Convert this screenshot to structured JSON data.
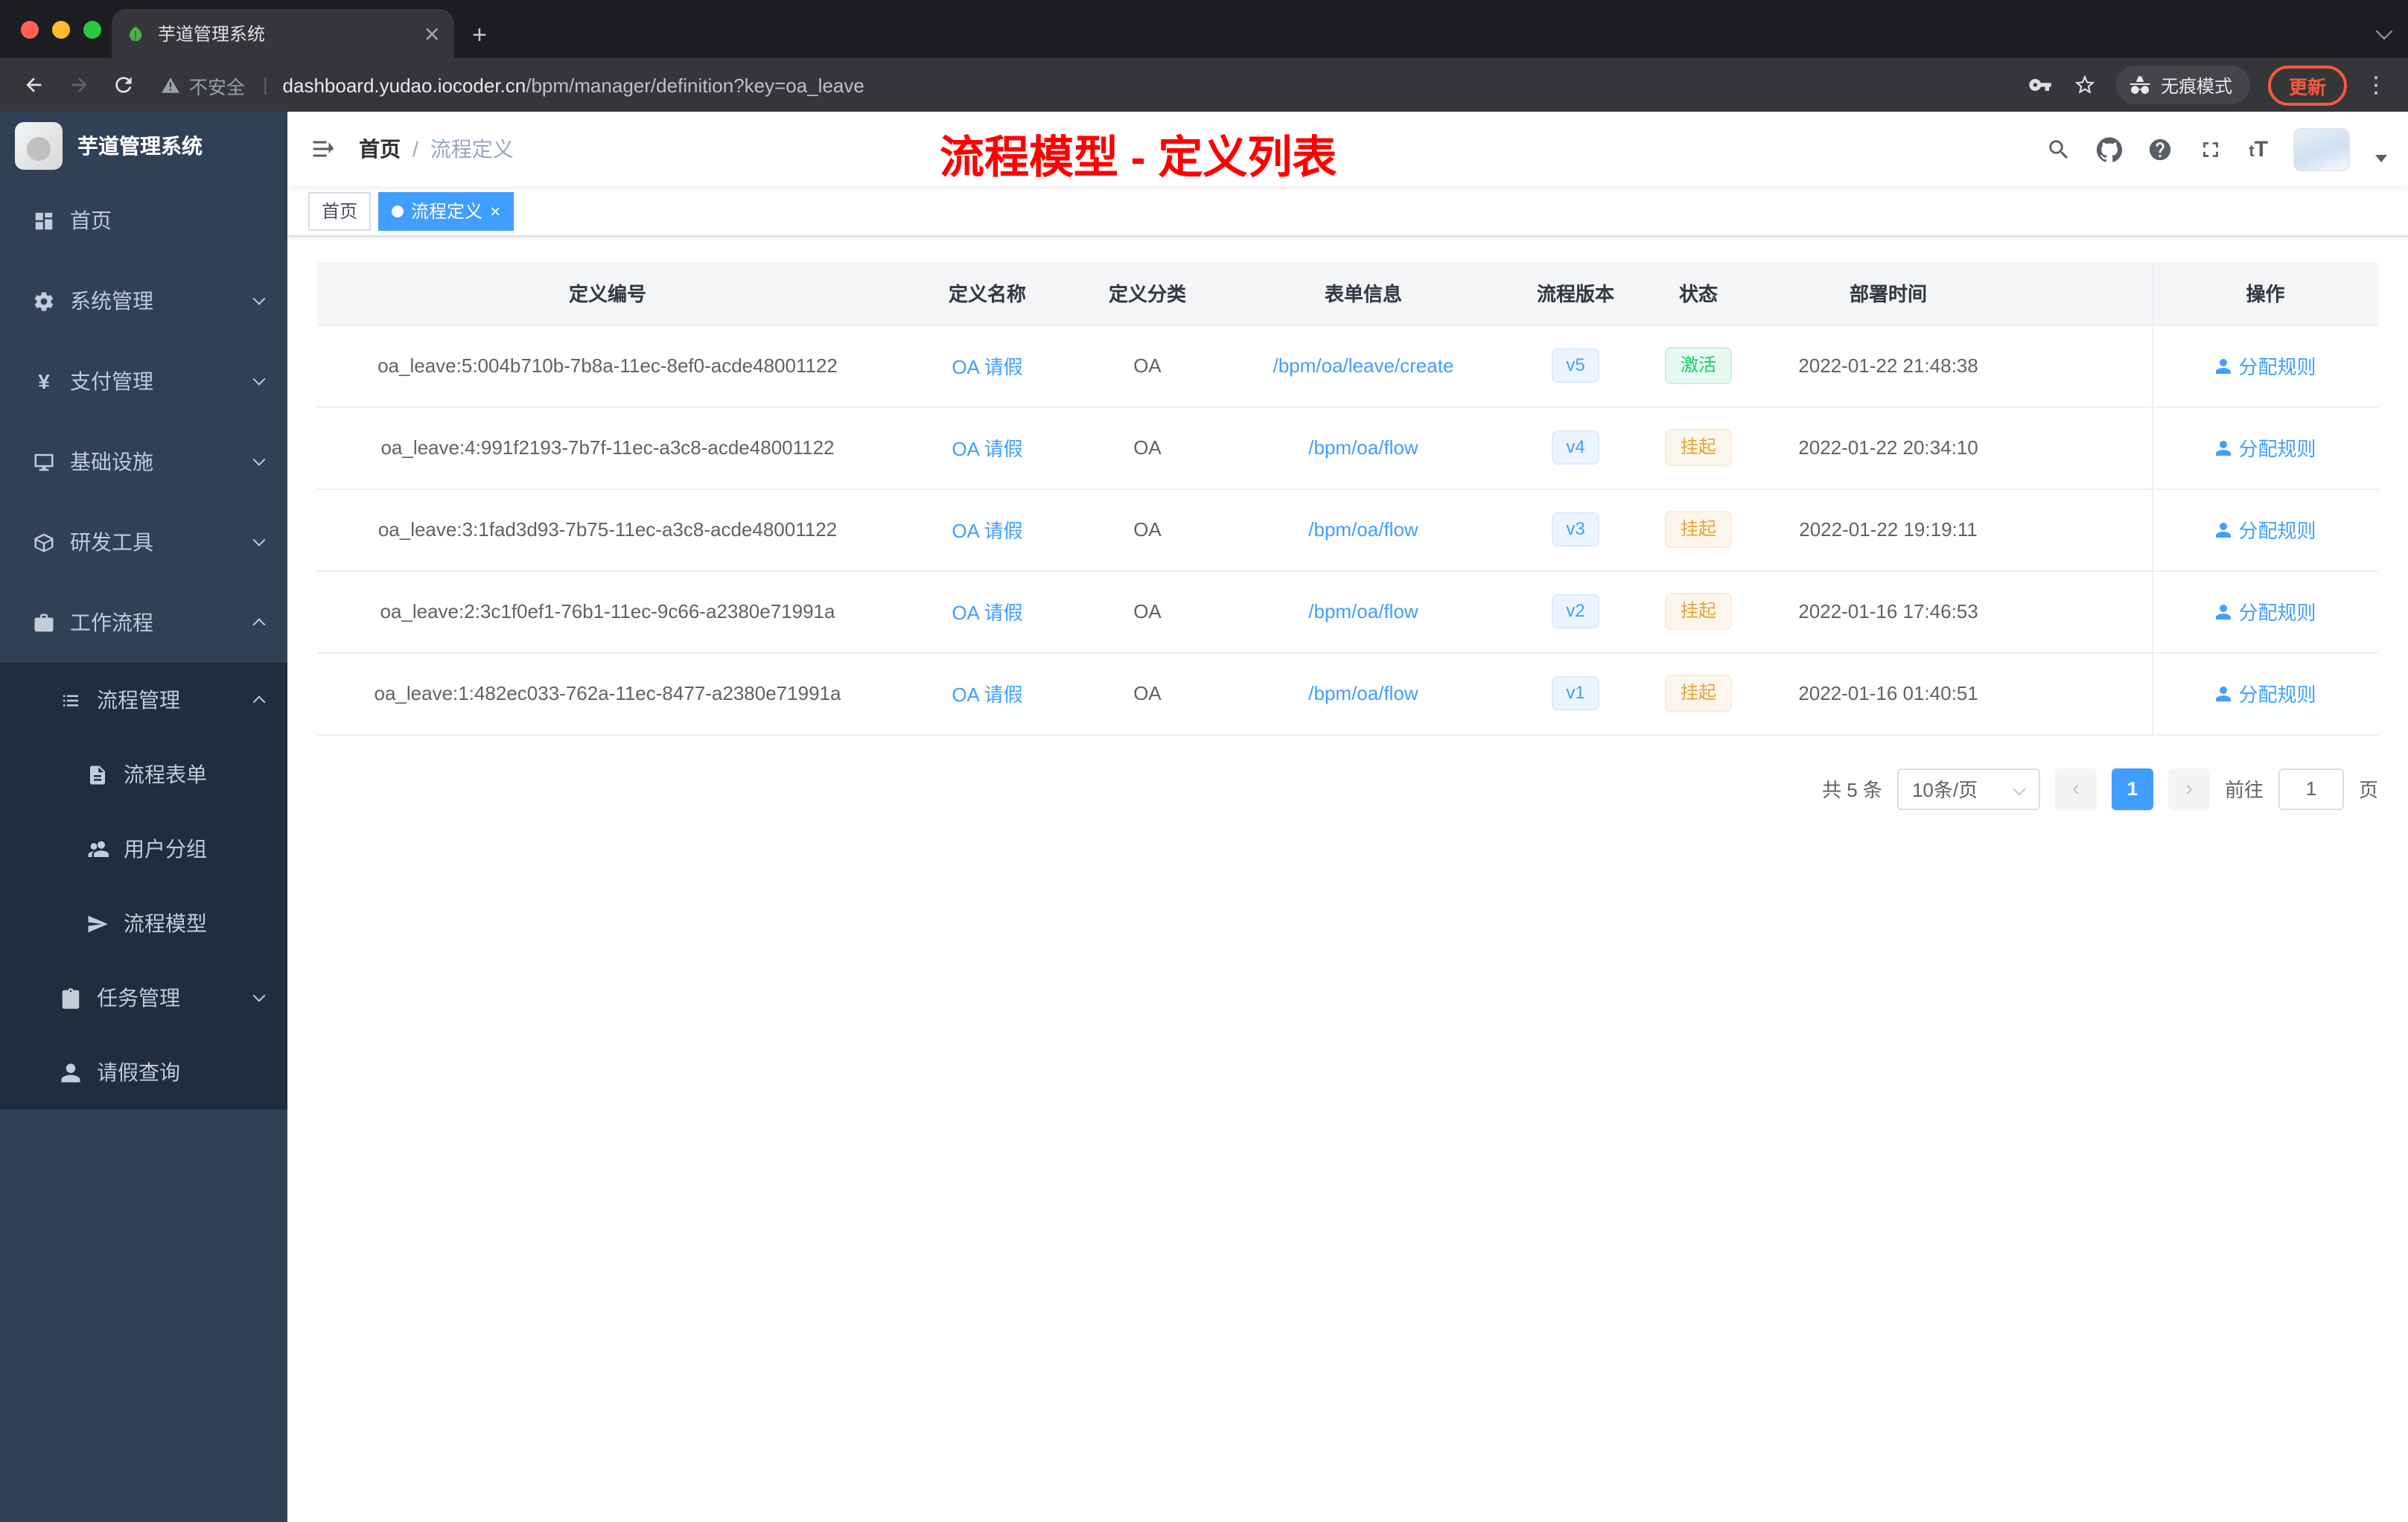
{
  "browser": {
    "tab_title": "芋道管理系统",
    "security_label": "不安全",
    "url_domain": "dashboard.yudao.iocoder.cn",
    "url_path": "/bpm/manager/definition?key=oa_leave",
    "incognito_label": "无痕模式",
    "update_label": "更新"
  },
  "sidebar": {
    "app_title": "芋道管理系统",
    "items": [
      {
        "label": "首页"
      },
      {
        "label": "系统管理"
      },
      {
        "label": "支付管理"
      },
      {
        "label": "基础设施"
      },
      {
        "label": "研发工具"
      },
      {
        "label": "工作流程"
      },
      {
        "label": "流程管理"
      },
      {
        "label": "流程表单"
      },
      {
        "label": "用户分组"
      },
      {
        "label": "流程模型"
      },
      {
        "label": "任务管理"
      },
      {
        "label": "请假查询"
      }
    ]
  },
  "navbar": {
    "breadcrumb_home": "首页",
    "breadcrumb_sep": "/",
    "breadcrumb_current": "流程定义",
    "annotation": "流程模型 - 定义列表"
  },
  "tags": {
    "home": "首页",
    "current": "流程定义"
  },
  "table": {
    "columns": {
      "id": "定义编号",
      "name": "定义名称",
      "category": "定义分类",
      "form": "表单信息",
      "version": "流程版本",
      "status": "状态",
      "deploy_time": "部署时间",
      "action": "操作"
    },
    "rows": [
      {
        "id": "oa_leave:5:004b710b-7b8a-11ec-8ef0-acde48001122",
        "name": "OA 请假",
        "category": "OA",
        "form": "/bpm/oa/leave/create",
        "version": "v5",
        "status": "激活",
        "deploy_time": "2022-01-22 21:48:38",
        "action": "分配规则"
      },
      {
        "id": "oa_leave:4:991f2193-7b7f-11ec-a3c8-acde48001122",
        "name": "OA 请假",
        "category": "OA",
        "form": "/bpm/oa/flow",
        "version": "v4",
        "status": "挂起",
        "deploy_time": "2022-01-22 20:34:10",
        "action": "分配规则"
      },
      {
        "id": "oa_leave:3:1fad3d93-7b75-11ec-a3c8-acde48001122",
        "name": "OA 请假",
        "category": "OA",
        "form": "/bpm/oa/flow",
        "version": "v3",
        "status": "挂起",
        "deploy_time": "2022-01-22 19:19:11",
        "action": "分配规则"
      },
      {
        "id": "oa_leave:2:3c1f0ef1-76b1-11ec-9c66-a2380e71991a",
        "name": "OA 请假",
        "category": "OA",
        "form": "/bpm/oa/flow",
        "version": "v2",
        "status": "挂起",
        "deploy_time": "2022-01-16 17:46:53",
        "action": "分配规则"
      },
      {
        "id": "oa_leave:1:482ec033-762a-11ec-8477-a2380e71991a",
        "name": "OA 请假",
        "category": "OA",
        "form": "/bpm/oa/flow",
        "version": "v1",
        "status": "挂起",
        "deploy_time": "2022-01-16 01:40:51",
        "action": "分配规则"
      }
    ]
  },
  "pagination": {
    "total": "共 5 条",
    "page_size": "10条/页",
    "page": "1",
    "goto": "前往",
    "goto_page": "1",
    "unit": "页"
  },
  "colors": {
    "accent_blue": "#409eff",
    "success_green": "#13ce66",
    "warning_orange": "#e6a23c",
    "annotation_red": "#ff0000",
    "sidebar_bg": "#304156",
    "submenu_bg": "#1f2d3d"
  }
}
